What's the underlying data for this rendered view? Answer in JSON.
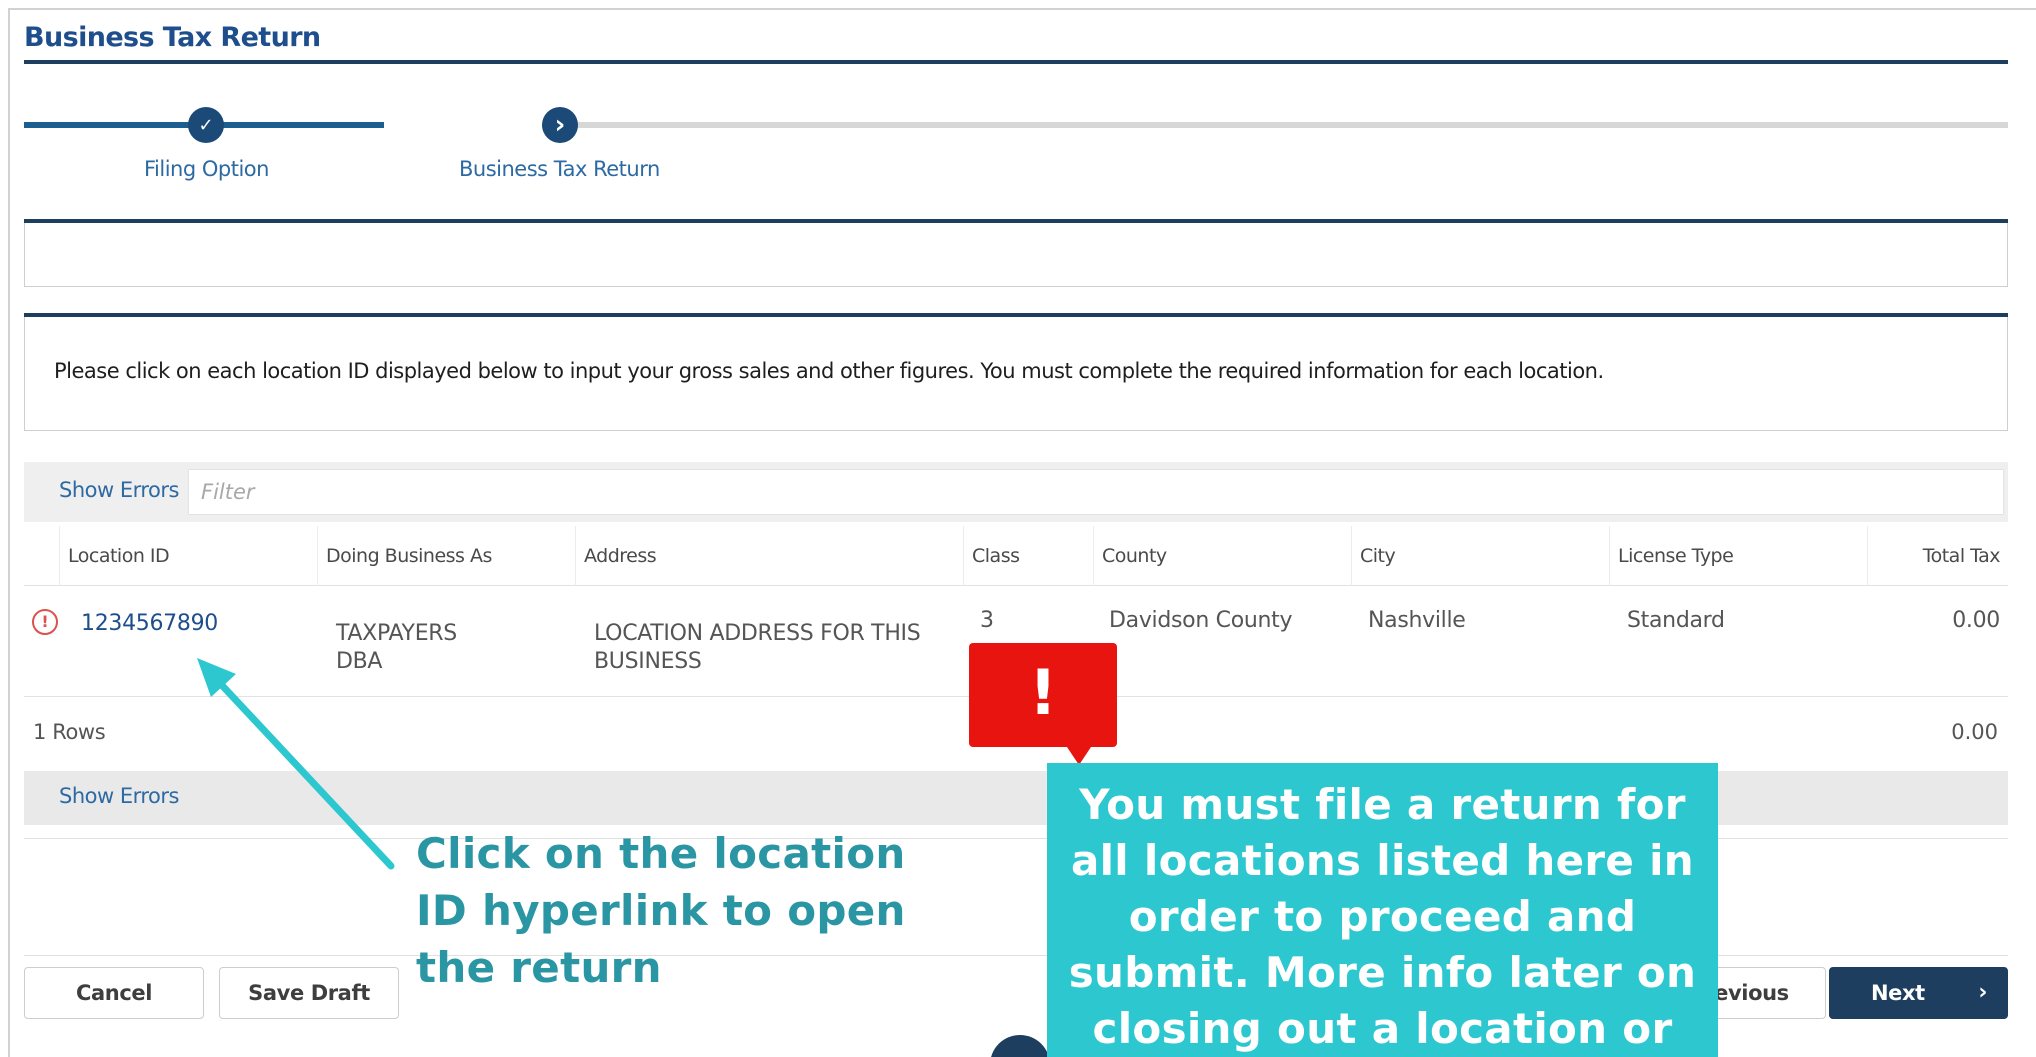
{
  "header": {
    "title": "Business Tax Return"
  },
  "stepper": {
    "steps": [
      {
        "label": "Filing Option",
        "status": "complete",
        "icon": "check-icon",
        "glyph": "✓"
      },
      {
        "label": "Business Tax Return",
        "status": "current",
        "icon": "chevron-right-icon",
        "glyph": "›"
      }
    ]
  },
  "instructions": "Please click on each location ID displayed below to input your gross sales and other figures. You must complete the required information for each location.",
  "grid": {
    "toolbar": {
      "show_errors": "Show Errors",
      "filter_placeholder": "Filter"
    },
    "columns": [
      "Location ID",
      "Doing Business As",
      "Address",
      "Class",
      "County",
      "City",
      "License Type",
      "Total Tax"
    ],
    "rows": [
      {
        "location_id": "1234567890",
        "dba": "TAXPAYERS DBA",
        "address": "LOCATION ADDRESS FOR THIS BUSINESS",
        "class": "3",
        "county": "Davidson County",
        "city": "Nashville",
        "license_type": "Standard",
        "total_tax": "0.00",
        "has_error": true
      }
    ],
    "row_count": "1 Rows",
    "total": "0.00",
    "footer_show_errors": "Show Errors"
  },
  "actions": {
    "cancel": "Cancel",
    "save_draft": "Save Draft",
    "previous": "Previous",
    "next": "Next",
    "next_icon": "chevron-right-icon"
  },
  "annotations": {
    "arrow_text": "Click on the location ID hyperlink to open the return",
    "alert_mark": "!",
    "note_text": "You must file a return for all locations listed here in order to proceed and submit.  More info later on closing out a location or",
    "colors": {
      "teal": "#2dc7cf",
      "teal_text": "#2a95a3",
      "alert_red": "#e8140f"
    }
  },
  "colors": {
    "navy": "#1d3e5f",
    "link": "#1f4e8c",
    "error": "#d9534f"
  }
}
